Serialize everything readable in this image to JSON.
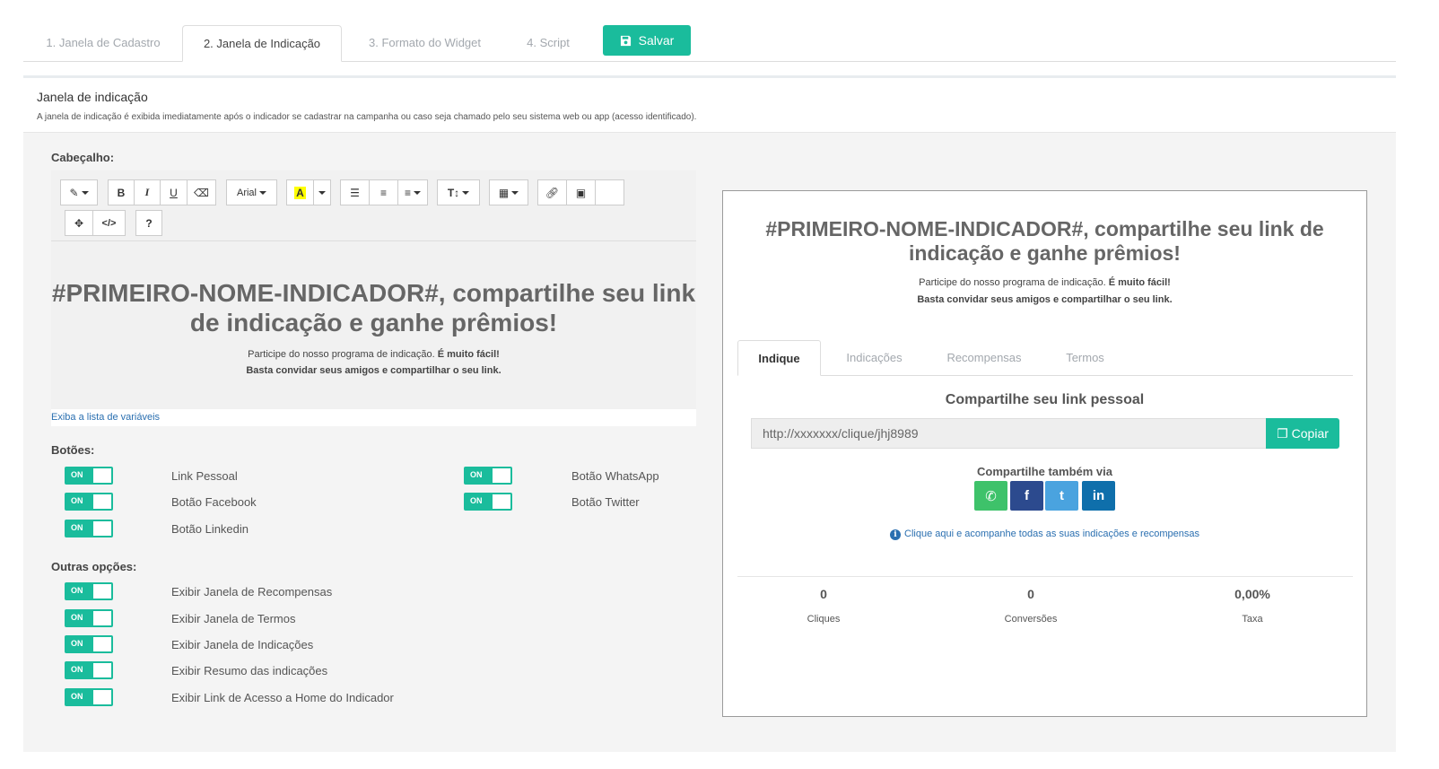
{
  "tabs": [
    {
      "label": "1. Janela de Cadastro"
    },
    {
      "label": "2. Janela de Indicação"
    },
    {
      "label": "3. Formato do Widget"
    },
    {
      "label": "4. Script"
    }
  ],
  "save_label": "Salvar",
  "section": {
    "title": "Janela de indicação",
    "description": "A janela de indicação é exibida imediatamente após o indicador se cadastrar na campanha ou caso seja chamado pelo seu sistema web ou app (acesso identificado)."
  },
  "header_label": "Cabeçalho:",
  "editor": {
    "font": "Arial",
    "heading": "#PRIMEIRO-NOME-INDICADOR#, compartilhe seu link de indicação e ganhe prêmios!",
    "intro": "Participe do nosso programa de indicação.",
    "intro_bold": "É muito fácil!",
    "line2": "Basta convidar seus amigos e compartilhar o seu link.",
    "variables_link": "Exiba a lista de variáveis"
  },
  "buttons_label": "Botões:",
  "toggle_on": "ON",
  "buttons": [
    {
      "label": "Link Pessoal",
      "on": true
    },
    {
      "label": "Botão WhatsApp",
      "on": true
    },
    {
      "label": "Botão Facebook",
      "on": true
    },
    {
      "label": "Botão Twitter",
      "on": true
    },
    {
      "label": "Botão Linkedin",
      "on": true
    }
  ],
  "other_label": "Outras opções:",
  "options": [
    {
      "label": "Exibir Janela de Recompensas",
      "on": true
    },
    {
      "label": "Exibir Janela de Termos",
      "on": true
    },
    {
      "label": "Exibir Janela de Indicações",
      "on": true
    },
    {
      "label": "Exibir Resumo das indicações",
      "on": true
    },
    {
      "label": "Exibir Link de Acesso a Home do Indicador",
      "on": true
    }
  ],
  "preview": {
    "heading": "#PRIMEIRO-NOME-INDICADOR#, compartilhe seu link de indicação e ganhe prêmios!",
    "intro": "Participe do nosso programa de indicação.",
    "intro_bold": "É muito fácil!",
    "line2": "Basta convidar seus amigos e compartilhar o seu link.",
    "tabs": [
      {
        "label": "Indique"
      },
      {
        "label": "Indicações"
      },
      {
        "label": "Recompensas"
      },
      {
        "label": "Termos"
      }
    ],
    "share_title": "Compartilhe seu link pessoal",
    "link_value": "http://xxxxxxx/clique/jhj8989",
    "copy_label": "Copiar",
    "also_title": "Compartilhe também via",
    "social": [
      {
        "name": "whatsapp",
        "color": "#3ec26a",
        "glyph": "✆"
      },
      {
        "name": "facebook",
        "color": "#2c4a8e",
        "glyph": "f"
      },
      {
        "name": "twitter",
        "color": "#4aa3df",
        "glyph": "t"
      },
      {
        "name": "linkedin",
        "color": "#0f6fab",
        "glyph": "in"
      }
    ],
    "info_link": "Clique aqui e acompanhe todas as suas indicações e recompensas",
    "stats": [
      {
        "value": "0",
        "label": "Cliques"
      },
      {
        "value": "0",
        "label": "Conversões"
      },
      {
        "value": "0,00%",
        "label": "Taxa"
      }
    ]
  },
  "colors": {
    "accent": "#1abc9c",
    "link": "#2a6fb0"
  }
}
